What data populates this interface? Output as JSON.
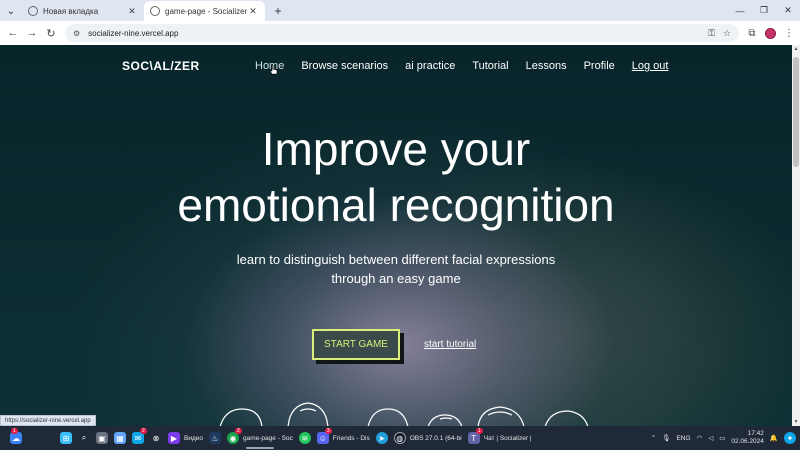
{
  "browser": {
    "tabs": [
      {
        "title": "Новая вкладка",
        "active": false
      },
      {
        "title": "game-page - Socializer",
        "active": true
      }
    ],
    "new_tab": "+",
    "window_controls": [
      "—",
      "❐",
      "✕"
    ],
    "url": "socializer-nine.vercel.app",
    "status_url": "https://socializer-nine.vercel.app"
  },
  "site": {
    "logo": "SOC\\AL/ZER",
    "nav": [
      {
        "label": "Home"
      },
      {
        "label": "Browse scenarios"
      },
      {
        "label": "ai practice"
      },
      {
        "label": "Tutorial"
      },
      {
        "label": "Lessons"
      },
      {
        "label": "Profile"
      },
      {
        "label": "Log out"
      }
    ],
    "hero": {
      "title_line1": "Improve your",
      "title_line2": "emotional recognition",
      "subtitle_line1": "learn to distinguish between different facial expressions",
      "subtitle_line2": "through an easy game"
    },
    "start_button": "START GAME",
    "tutorial_link": "start tutorial"
  },
  "taskbar": {
    "items": [
      {
        "label": "",
        "icon": "weather-icon",
        "badge": "1"
      },
      {
        "label": "",
        "icon": "windows-start-icon"
      },
      {
        "label": "",
        "icon": "search-icon"
      },
      {
        "label": "",
        "icon": "task-view-icon"
      },
      {
        "label": "",
        "icon": "widgets-icon"
      },
      {
        "label": "",
        "icon": "mail-icon",
        "badge": "2"
      },
      {
        "label": "",
        "icon": "xbox-icon"
      },
      {
        "label": "Видео",
        "icon": "video-icon"
      },
      {
        "label": "",
        "icon": "steam-icon"
      },
      {
        "label": "game-page - Soc",
        "icon": "chrome-icon",
        "badge": "2"
      },
      {
        "label": "",
        "icon": "spotify-icon"
      },
      {
        "label": "Friends - Dis",
        "icon": "discord-icon",
        "badge": "3"
      },
      {
        "label": "",
        "icon": "telegram-icon"
      },
      {
        "label": "OBS 27.0.1 (64-bi",
        "icon": "obs-icon"
      },
      {
        "label": "Чат | Socializer |",
        "icon": "teams-icon",
        "badge": "1"
      }
    ],
    "tray": {
      "lang": "ENG",
      "time": "17:42",
      "date": "02.06.2024"
    }
  },
  "colors": {
    "accent": "#d8f07a",
    "page_bg": "#0b2a2e",
    "avatar": "#c9326a"
  }
}
